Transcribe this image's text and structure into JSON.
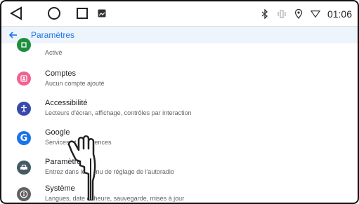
{
  "status_bar": {
    "time": "01:06"
  },
  "toolbar": {
    "title": "Paramètres"
  },
  "items": [
    {
      "title": "",
      "subtitle": "Activé",
      "icon": "green-badge-icon",
      "color": "#1e8e3e"
    },
    {
      "title": "Comptes",
      "subtitle": "Aucun compte ajouté",
      "icon": "account-card-icon",
      "color": "#f06292"
    },
    {
      "title": "Accessibilité",
      "subtitle": "Lecteurs d'écran, affichage, contrôles par interaction",
      "icon": "accessibility-icon",
      "color": "#3949ab"
    },
    {
      "title": "Google",
      "subtitle": "Services et préférences",
      "icon": "google-icon",
      "color": "#1a73e8"
    },
    {
      "title": "Paramètres",
      "subtitle": "Entrez dans le menu de réglage de l'autoradio",
      "icon": "car-icon",
      "color": "#455a64"
    },
    {
      "title": "Système",
      "subtitle": "Langues, date et heure, sauvegarde, mises à jour",
      "icon": "info-icon",
      "color": "#616161"
    }
  ],
  "colors": {
    "accent": "#1a73e8",
    "toolbar_bg": "#eef4fb"
  }
}
